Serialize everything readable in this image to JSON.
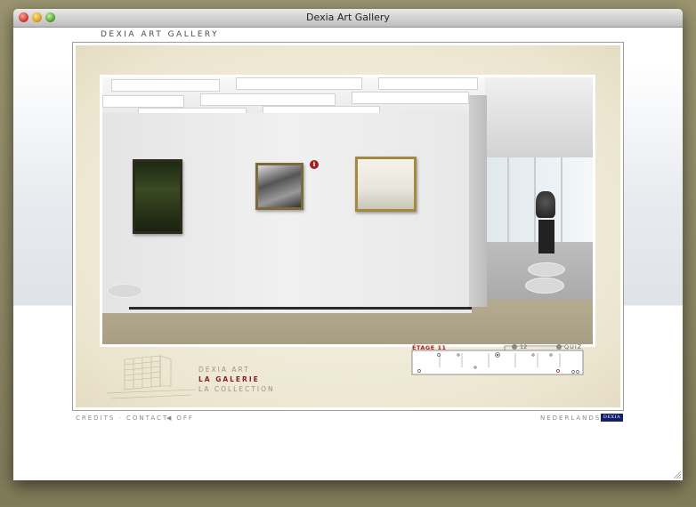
{
  "window": {
    "title": "Dexia Art Gallery"
  },
  "header": {
    "brand": "DEXIA ART GALLERY"
  },
  "gallery": {
    "info_icon": "info-icon",
    "nav": {
      "item1": "DEXIA ART",
      "item2": "LA GALERIE",
      "item3": "LA COLLECTION"
    },
    "floorplan": {
      "floor_label": "ÉTAGE 11",
      "level_label": "12",
      "quiz_label": "QUIZ"
    }
  },
  "footer": {
    "credits": "CREDITS · CONTACT",
    "sound": "OFF",
    "language": "NEDERLANDS",
    "logo": "DEXIA"
  },
  "colors": {
    "accent": "#a21e22",
    "logo_bg": "#14206b",
    "frame_beige": "#ece6d0"
  }
}
